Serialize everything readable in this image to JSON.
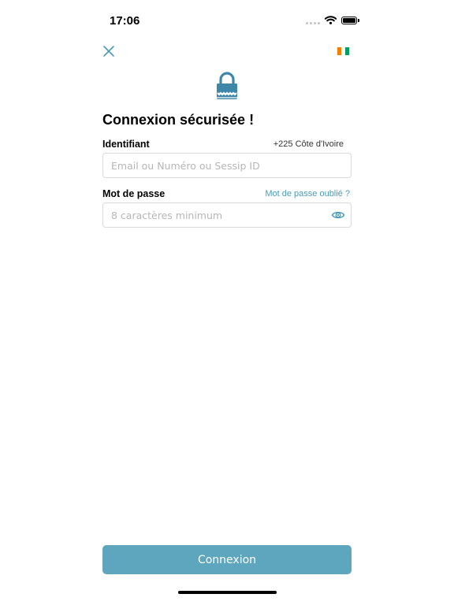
{
  "status_bar": {
    "time": "17:06"
  },
  "header": {
    "close_icon": "close-icon",
    "flag_colors": [
      "#f77f00",
      "#ffffff",
      "#009e60"
    ]
  },
  "lock_icon": {
    "name": "lock-icon",
    "color": "#3f87a8"
  },
  "title": "Connexion sécurisée !",
  "identifier": {
    "label": "Identifiant",
    "country": "+225 Côte d'Ivoire",
    "placeholder": "Email ou Numéro ou Sessip ID",
    "value": ""
  },
  "password": {
    "label": "Mot de passe",
    "forgot": "Mot de passe oublié ?",
    "placeholder": "8 caractères minimum",
    "value": ""
  },
  "submit_label": "Connexion",
  "colors": {
    "accent": "#5ea6bd",
    "link": "#4a9bb8"
  }
}
